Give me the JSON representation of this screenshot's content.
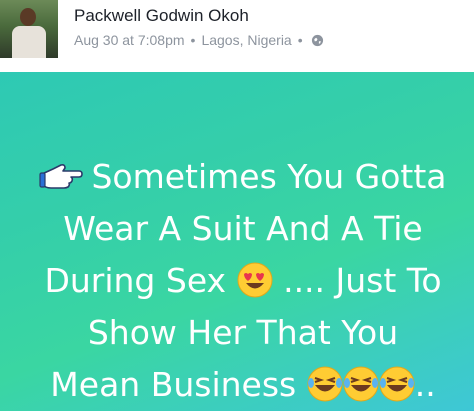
{
  "author": {
    "name": "Packwell Godwin Okoh"
  },
  "meta": {
    "time": "Aug 30 at 7:08pm",
    "location": "Lagos, Nigeria",
    "privacy_icon": "globe-icon"
  },
  "post": {
    "line1": "Sometimes You Gotta",
    "line2": "Wear A Suit And A Tie",
    "line3a": "During Sex",
    "line3b": ".... Just To",
    "line4": "Show Her That You",
    "line5": "Mean Business",
    "line5_tail": "..",
    "icons": [
      "pointing-hand-icon",
      "heart-eyes-emoji",
      "laughing-tears-emoji"
    ]
  },
  "colors": {
    "background_start": "#2ec9b4",
    "background_end": "#3ec7d6",
    "text": "#ffffff"
  }
}
